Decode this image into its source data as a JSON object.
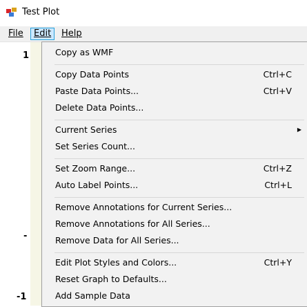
{
  "window": {
    "title": "Test Plot",
    "icon": "app-icon"
  },
  "menubar": {
    "file": "File",
    "edit": "Edit",
    "help": "Help"
  },
  "axis_ticks": [
    "1",
    "-",
    "-1"
  ],
  "edit_menu": {
    "copy_wmf": "Copy as WMF",
    "copy_points": "Copy Data Points",
    "copy_points_shortcut": "Ctrl+C",
    "paste_points": "Paste Data Points...",
    "paste_points_shortcut": "Ctrl+V",
    "delete_points": "Delete Data Points...",
    "current_series": "Current Series",
    "submenu_arrow": "▶",
    "set_series_count": "Set Series Count...",
    "set_zoom": "Set Zoom Range...",
    "set_zoom_shortcut": "Ctrl+Z",
    "auto_label": "Auto Label Points...",
    "auto_label_shortcut": "Ctrl+L",
    "remove_ann_current": "Remove Annotations for Current Series...",
    "remove_ann_all": "Remove Annotations for All Series...",
    "remove_data_all": "Remove Data for All Series...",
    "edit_styles": "Edit Plot Styles and Colors...",
    "edit_styles_shortcut": "Ctrl+Y",
    "reset_graph": "Reset Graph to Defaults...",
    "add_sample": "Add Sample Data"
  }
}
